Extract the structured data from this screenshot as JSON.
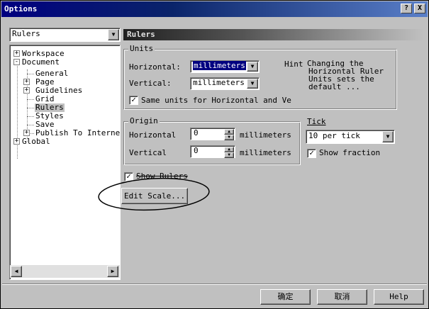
{
  "window": {
    "title": "Options",
    "help_glyph": "?",
    "close_glyph": "X"
  },
  "category_combo": {
    "value": "Rulers"
  },
  "tree": {
    "items": [
      {
        "label": "Workspace",
        "expander": "+"
      },
      {
        "label": "Document",
        "expander": "-"
      },
      {
        "label": "General"
      },
      {
        "label": "Page",
        "expander": "+"
      },
      {
        "label": "Guidelines",
        "expander": "+"
      },
      {
        "label": "Grid"
      },
      {
        "label": "Rulers"
      },
      {
        "label": "Styles"
      },
      {
        "label": "Save"
      },
      {
        "label": "Publish To Interne",
        "expander": "+"
      },
      {
        "label": "Global",
        "expander": "+"
      }
    ]
  },
  "panel_title": "Rulers",
  "units": {
    "group_title": "Units",
    "horizontal_label": "Horizontal:",
    "horizontal_value": "millimeters",
    "vertical_label": "Vertical:",
    "vertical_value": "millimeters",
    "hint_label": "Hint",
    "hint_lines": [
      "Changing the",
      "Horizontal Ruler",
      "Units sets the",
      "default ..."
    ],
    "same_units_label": "Same units for Horizontal and Vertica",
    "same_units_checked": true
  },
  "origin": {
    "group_title": "Origin",
    "horizontal_label": "Horizontal",
    "horizontal_value": "0",
    "horizontal_unit": "millimeters",
    "vertical_label": "Vertical",
    "vertical_value": "0",
    "vertical_unit": "millimeters"
  },
  "tick": {
    "label": "Tick",
    "value": "10 per tick",
    "show_fraction_label": "Show fraction",
    "show_fraction_checked": true
  },
  "show_rulers": {
    "label": "Show Rulers",
    "checked": true
  },
  "edit_scale_button": "Edit Scale...",
  "footer": {
    "ok": "确定",
    "cancel": "取消",
    "help": "Help"
  }
}
